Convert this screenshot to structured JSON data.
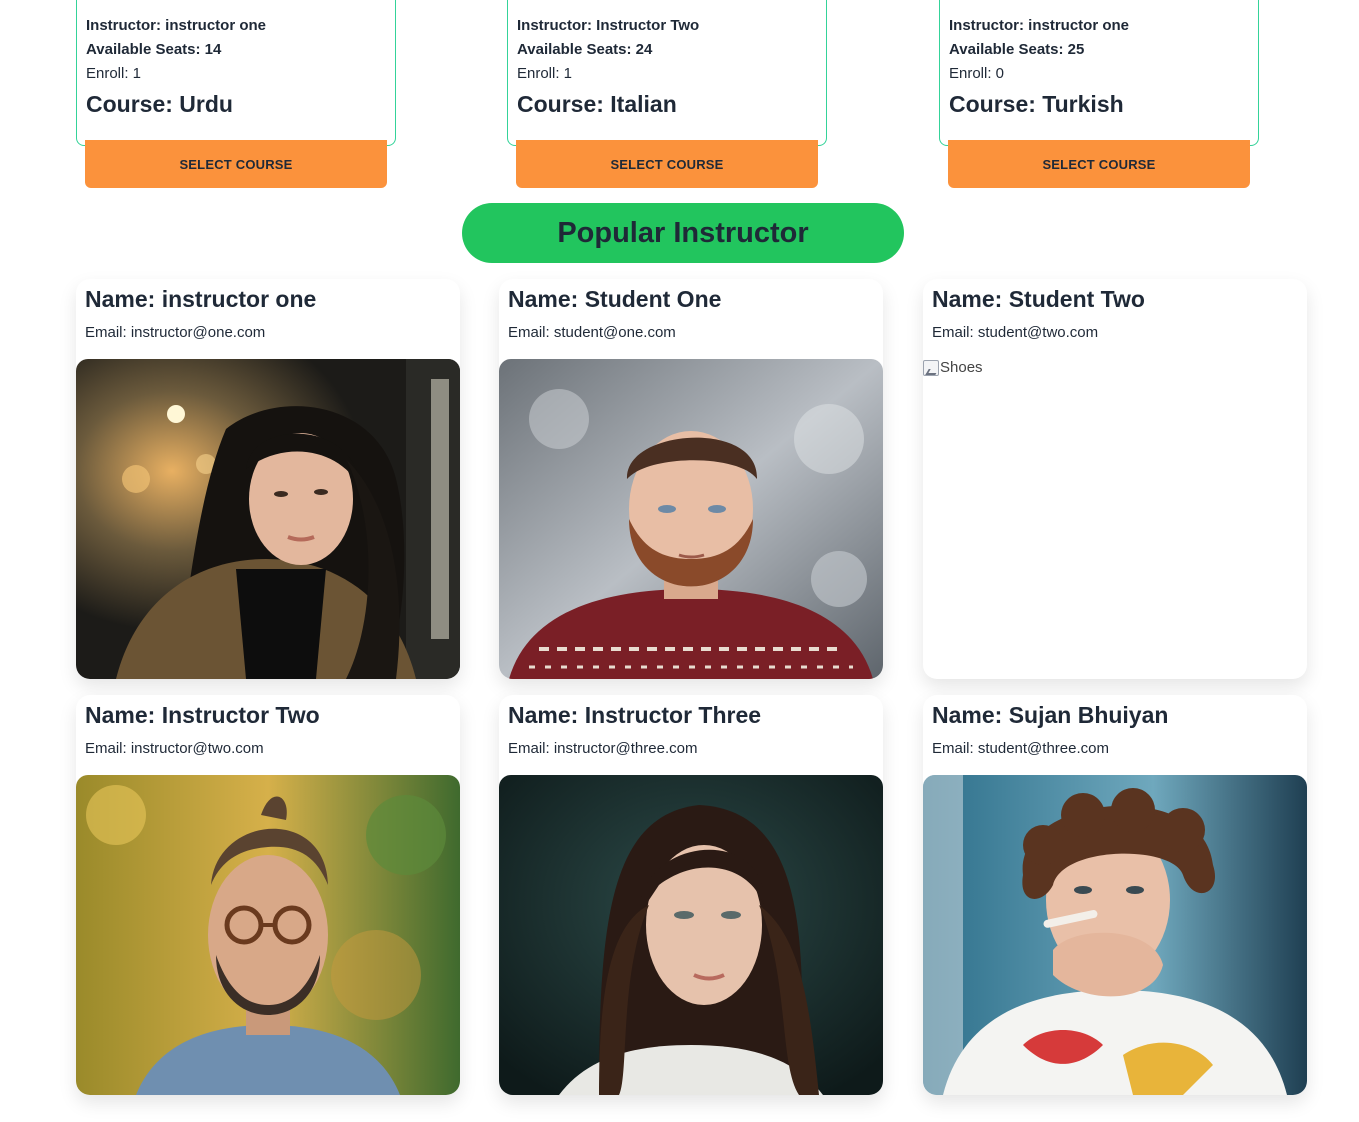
{
  "courses": [
    {
      "instructor": "Instructor: instructor one",
      "seats": "Available Seats: 14",
      "enroll": "Enroll: 1",
      "course": "Course: Urdu",
      "button": "SELECT COURSE"
    },
    {
      "instructor": "Instructor: Instructor Two",
      "seats": "Available Seats: 24",
      "enroll": "Enroll: 1",
      "course": "Course: Italian",
      "button": "SELECT COURSE"
    },
    {
      "instructor": "Instructor: instructor one",
      "seats": "Available Seats: 25",
      "enroll": "Enroll: 0",
      "course": "Course: Turkish",
      "button": "SELECT COURSE"
    }
  ],
  "section_title": "Popular Instructor",
  "people": [
    {
      "name": "Name: instructor one",
      "email": "Email: instructor@one.com"
    },
    {
      "name": "Name: Student One",
      "email": "Email: student@one.com"
    },
    {
      "name": "Name: Student Two",
      "email": "Email: student@two.com",
      "image_alt": "Shoes"
    },
    {
      "name": "Name: Instructor Two",
      "email": "Email: instructor@two.com"
    },
    {
      "name": "Name: Instructor Three",
      "email": "Email: instructor@three.com"
    },
    {
      "name": "Name: Sujan Bhuiyan",
      "email": "Email: student@three.com"
    }
  ],
  "colors": {
    "accent_green": "#22c55e",
    "card_border": "#34d399",
    "button_orange": "#fb923c",
    "text": "#1f2937"
  }
}
